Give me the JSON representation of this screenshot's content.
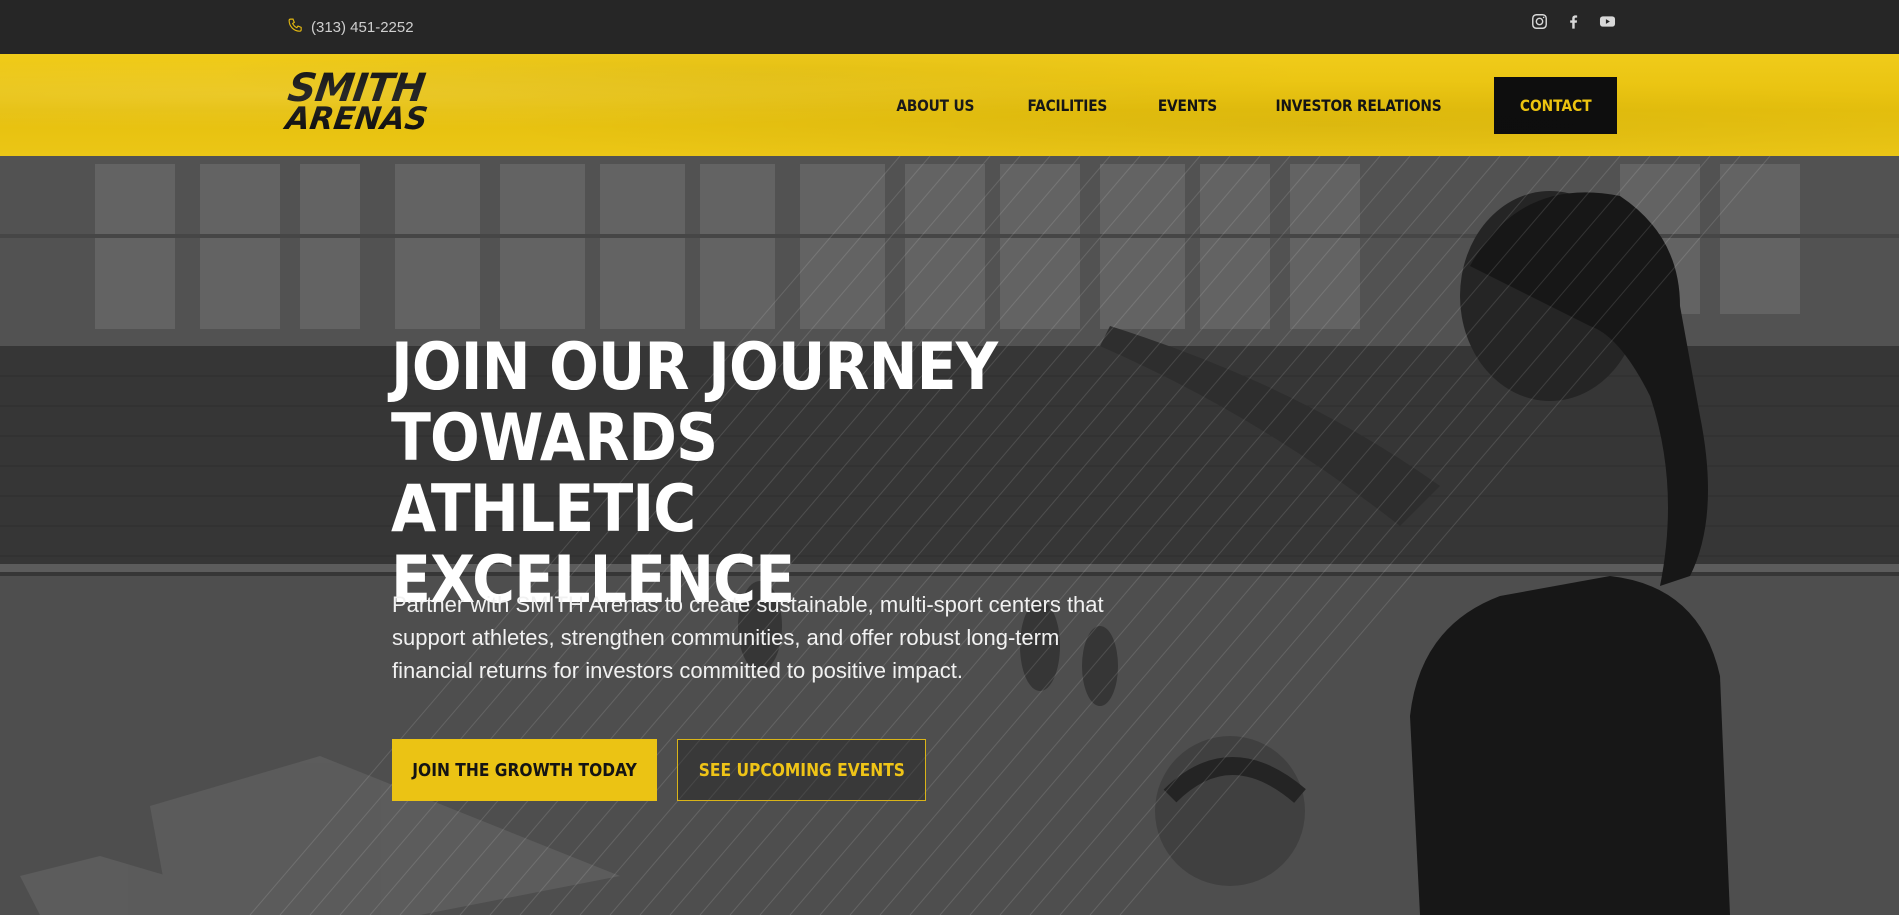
{
  "topbar": {
    "phone": "(313) 451-2252",
    "phone_icon": "phone-icon",
    "social": [
      {
        "name": "instagram",
        "icon": "instagram-icon"
      },
      {
        "name": "facebook",
        "icon": "facebook-icon"
      },
      {
        "name": "youtube",
        "icon": "youtube-icon"
      }
    ]
  },
  "header": {
    "logo_line1": "SMITH",
    "logo_line2": "ARENAS",
    "nav": [
      "ABOUT US",
      "FACILITIES",
      "EVENTS",
      "INVESTOR RELATIONS"
    ],
    "contact_label": "CONTACT"
  },
  "hero": {
    "title_lines": [
      "JOIN OUR JOURNEY",
      "TOWARDS ATHLETIC",
      "EXCELLENCE"
    ],
    "subtitle": "Partner with SMITH Arenas to create sustainable, multi-sport centers that support athletes, strengthen communities, and offer robust long-term financial returns for investors committed to positive impact.",
    "primary_cta": "JOIN THE GROWTH TODAY",
    "secondary_cta": "SEE UPCOMING EVENTS"
  },
  "colors": {
    "accent": "#ebc314",
    "topbar_bg": "#262626",
    "dark": "#0e0e0e"
  }
}
